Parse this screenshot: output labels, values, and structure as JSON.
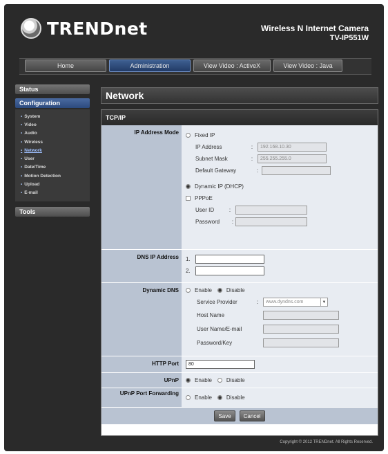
{
  "brand": {
    "logo_text": "TRENDnet",
    "product_name": "Wireless N Internet Camera",
    "model": "TV-IP551W"
  },
  "nav": [
    {
      "label": "Home",
      "active": false
    },
    {
      "label": "Administration",
      "active": true
    },
    {
      "label": "View Video : ActiveX",
      "active": false
    },
    {
      "label": "View Video : Java",
      "active": false
    }
  ],
  "menu": {
    "status": "Status",
    "configuration": "Configuration",
    "items": [
      "System",
      "Video",
      "Audio",
      "Wireless",
      "Network",
      "User",
      "Date/Time",
      "Motion Detection",
      "Upload",
      "E-mail"
    ],
    "current_item": "Network",
    "tools": "Tools"
  },
  "page": {
    "title": "Network",
    "section": "TCP/IP"
  },
  "ip_mode": {
    "label": "IP Address Mode",
    "fixed_ip": "Fixed IP",
    "ip_address_label": "IP Address",
    "ip_address": "192.168.10.30",
    "subnet_label": "Subnet Mask",
    "subnet": "255.255.255.0",
    "gateway_label": "Default Gateway",
    "gateway": "",
    "dhcp": "Dynamic IP (DHCP)",
    "pppoe": "PPPoE",
    "user_id_label": "User ID",
    "user_id": "",
    "password_label": "Password",
    "password": "",
    "selected": "Dynamic IP (DHCP)"
  },
  "dns": {
    "label": "DNS IP Address",
    "n1": "1.",
    "n2": "2.",
    "dns1": "",
    "dns2": ""
  },
  "ddns": {
    "label": "Dynamic DNS",
    "enable": "Enable",
    "disable": "Disable",
    "selected": "Disable",
    "provider_label": "Service Provider",
    "provider": "www.dyndns.com",
    "host_label": "Host Name",
    "user_label": "User Name/E-mail",
    "pass_label": "Password/Key"
  },
  "http": {
    "label": "HTTP Port",
    "value": "80"
  },
  "upnp": {
    "label": "UPnP",
    "enable": "Enable",
    "disable": "Disable",
    "selected": "Enable"
  },
  "upnp_fwd": {
    "label": "UPnP Port Forwarding",
    "enable": "Enable",
    "disable": "Disable",
    "selected": "Disable"
  },
  "buttons": {
    "save": "Save",
    "cancel": "Cancel"
  },
  "footer": {
    "copyright": "Copyright © 2012 TRENDnet. All Rights Reserved."
  }
}
